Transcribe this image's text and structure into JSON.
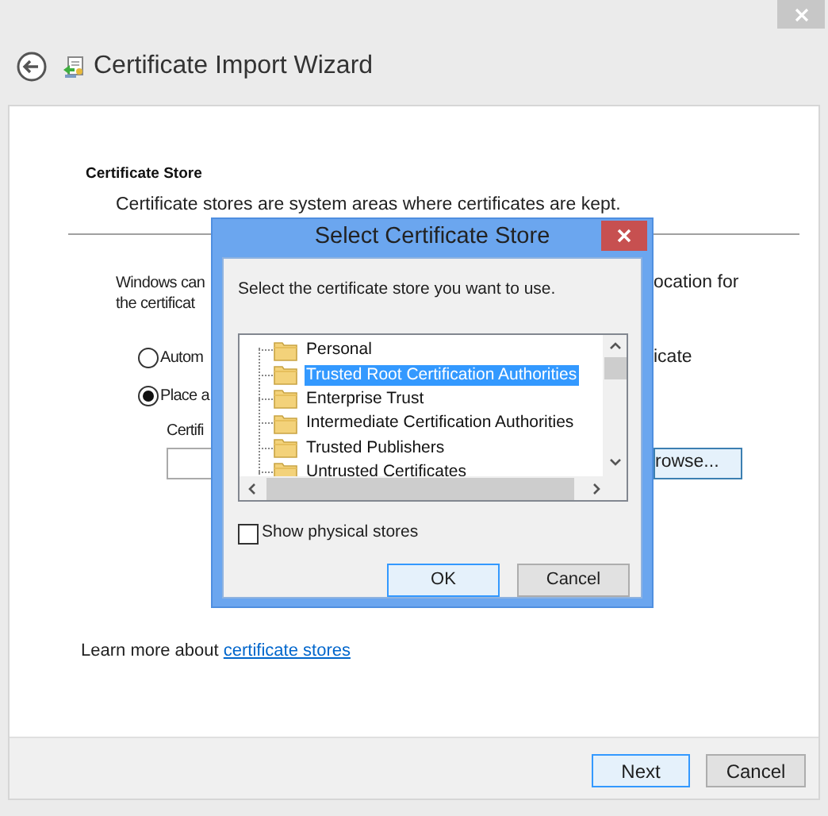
{
  "window": {
    "title": "Certificate Import Wizard"
  },
  "section": {
    "heading": "Certificate Store",
    "description": "Certificate stores are system areas where certificates are kept."
  },
  "intro": {
    "lines": [
      "Windows can",
      "the certificat"
    ],
    "right_text": "ocation for"
  },
  "options": [
    {
      "label": "Autom",
      "label_right": "icate",
      "selected": false
    },
    {
      "label": "Place a",
      "selected": true
    }
  ],
  "store_field": {
    "label": "Certifi",
    "browse_button": "rowse..."
  },
  "learn_more": {
    "text": "Learn more about",
    "link": "certificate stores"
  },
  "buttons": [
    {
      "label": "Next",
      "default": true
    },
    {
      "label": "Cancel",
      "default": false
    }
  ],
  "dialog": {
    "title": "Select Certificate Store",
    "prompt": "Select the certificate store you want to use.",
    "stores": [
      {
        "label": "Personal",
        "selected": false
      },
      {
        "label": "Trusted Root Certification Authorities",
        "selected": true
      },
      {
        "label": "Enterprise Trust",
        "selected": false
      },
      {
        "label": "Intermediate Certification Authorities",
        "selected": false
      },
      {
        "label": "Trusted Publishers",
        "selected": false
      },
      {
        "label": "Untrusted Certificates",
        "selected": false
      }
    ],
    "show_physical_stores": {
      "label": "Show physical stores",
      "checked": false
    },
    "buttons": [
      {
        "label": "OK",
        "default": true
      },
      {
        "label": "Cancel",
        "default": false
      }
    ]
  }
}
